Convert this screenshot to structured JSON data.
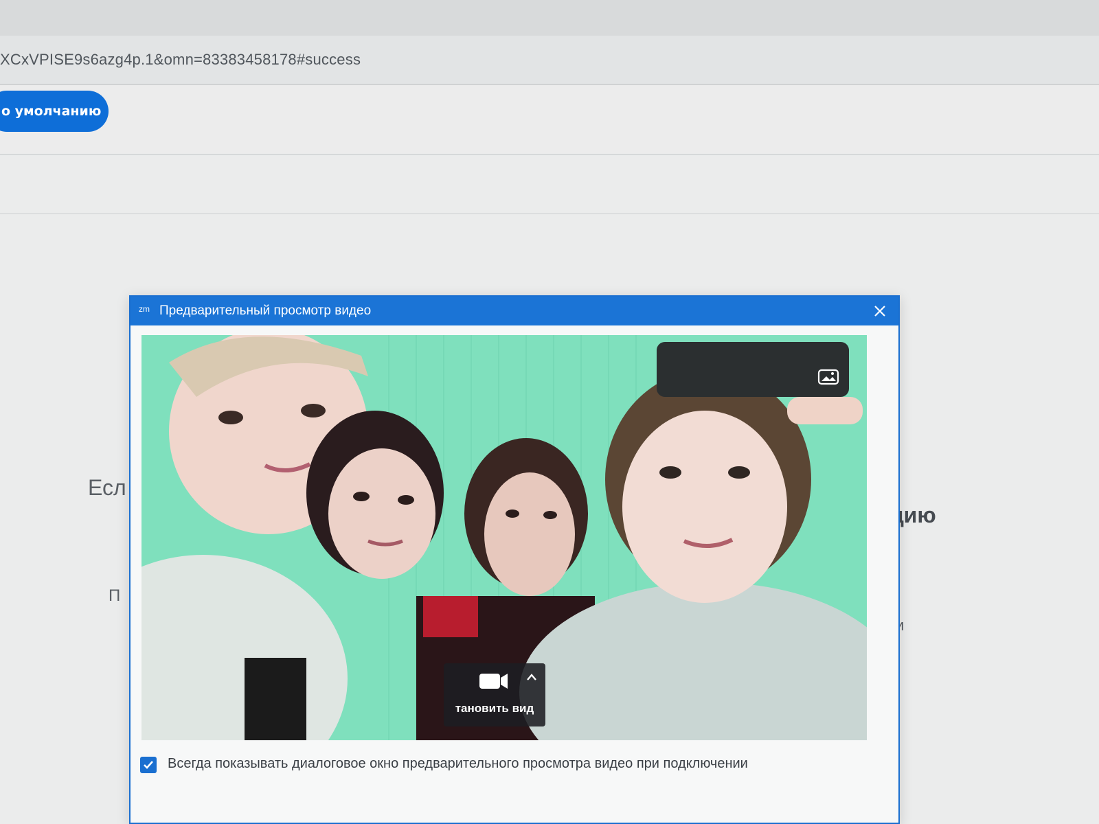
{
  "browser": {
    "url_fragment": "XCxVPISE9s6azg4p.1&omn=83383458178#success"
  },
  "toolbar": {
    "default_button_label": "о умолчанию"
  },
  "page": {
    "fragment_left_heading": "Есл",
    "fragment_right_heading": "цию",
    "fragment_left_text": "П",
    "fragment_right_text": "и"
  },
  "dialog": {
    "app_logo": "zm",
    "title": "Предварительный просмотр видео",
    "close_icon": "close-icon",
    "video": {
      "background_color": "#7fe0bd",
      "camera_icon": "video-camera-icon",
      "caret_icon": "chevron-up-icon",
      "camera_label": "тановить вид",
      "overlay_icon": "picture-icon"
    },
    "always_show_preview": {
      "checked": true,
      "label": "Всегда показывать диалоговое окно предварительного просмотра видео при подключении"
    }
  },
  "colors": {
    "accent": "#1b74d6",
    "button": "#0e6ed8",
    "page_bg": "#e9eaea"
  }
}
